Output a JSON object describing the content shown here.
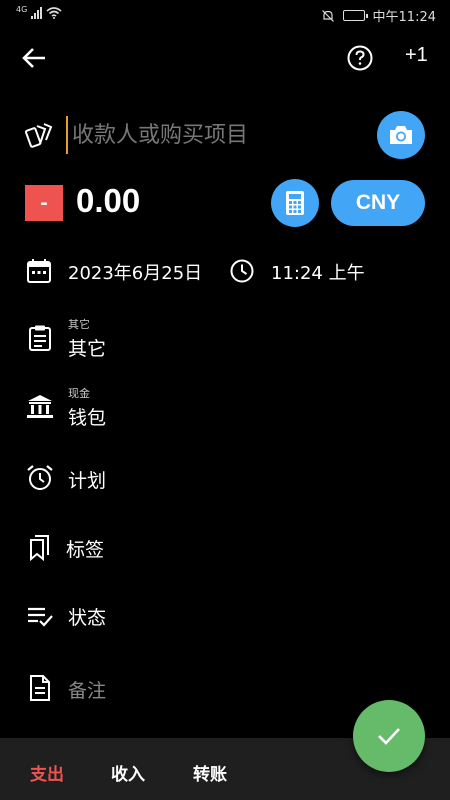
{
  "status_bar": {
    "network": "4G",
    "time": "中午11:24",
    "icons": [
      "signal-icon",
      "wifi-icon",
      "silent-icon",
      "battery-icon"
    ],
    "battery_level": 0.85
  },
  "app_bar": {
    "icons": [
      "back-arrow-icon",
      "help-icon"
    ],
    "plus_label": "+1"
  },
  "payee": {
    "icon": "cards-icon",
    "placeholder": "收款人或购买项目",
    "value": ""
  },
  "amount": {
    "sign": "-",
    "value": "0.00",
    "currency": "CNY",
    "icons": [
      "camera-icon",
      "calculator-icon"
    ]
  },
  "datetime": {
    "date": "2023年6月25日",
    "time": "11:24 上午",
    "icons": [
      "calendar-icon",
      "clock-icon"
    ]
  },
  "fields": {
    "category": {
      "sub": "其它",
      "value": "其它",
      "icon": "clipboard-icon"
    },
    "account": {
      "sub": "现金",
      "value": "钱包",
      "icon": "bank-icon"
    },
    "schedule": {
      "value": "计划",
      "icon": "alarm-icon"
    },
    "tags": {
      "value": "标签",
      "icon": "bookmarks-icon"
    },
    "status": {
      "value": "状态",
      "icon": "list-check-icon"
    },
    "notes": {
      "value": "备注",
      "icon": "document-icon"
    }
  },
  "fab": {
    "icon": "check-icon"
  },
  "bottom_tabs": {
    "expense": "支出",
    "income": "收入",
    "transfer": "转账",
    "active": "expense"
  },
  "colors": {
    "accent_blue": "#42a5f5",
    "expense_red": "#ef5350",
    "fab_green": "#66bb6a",
    "background": "#000000",
    "bottom_bar": "#1f1f1f"
  }
}
